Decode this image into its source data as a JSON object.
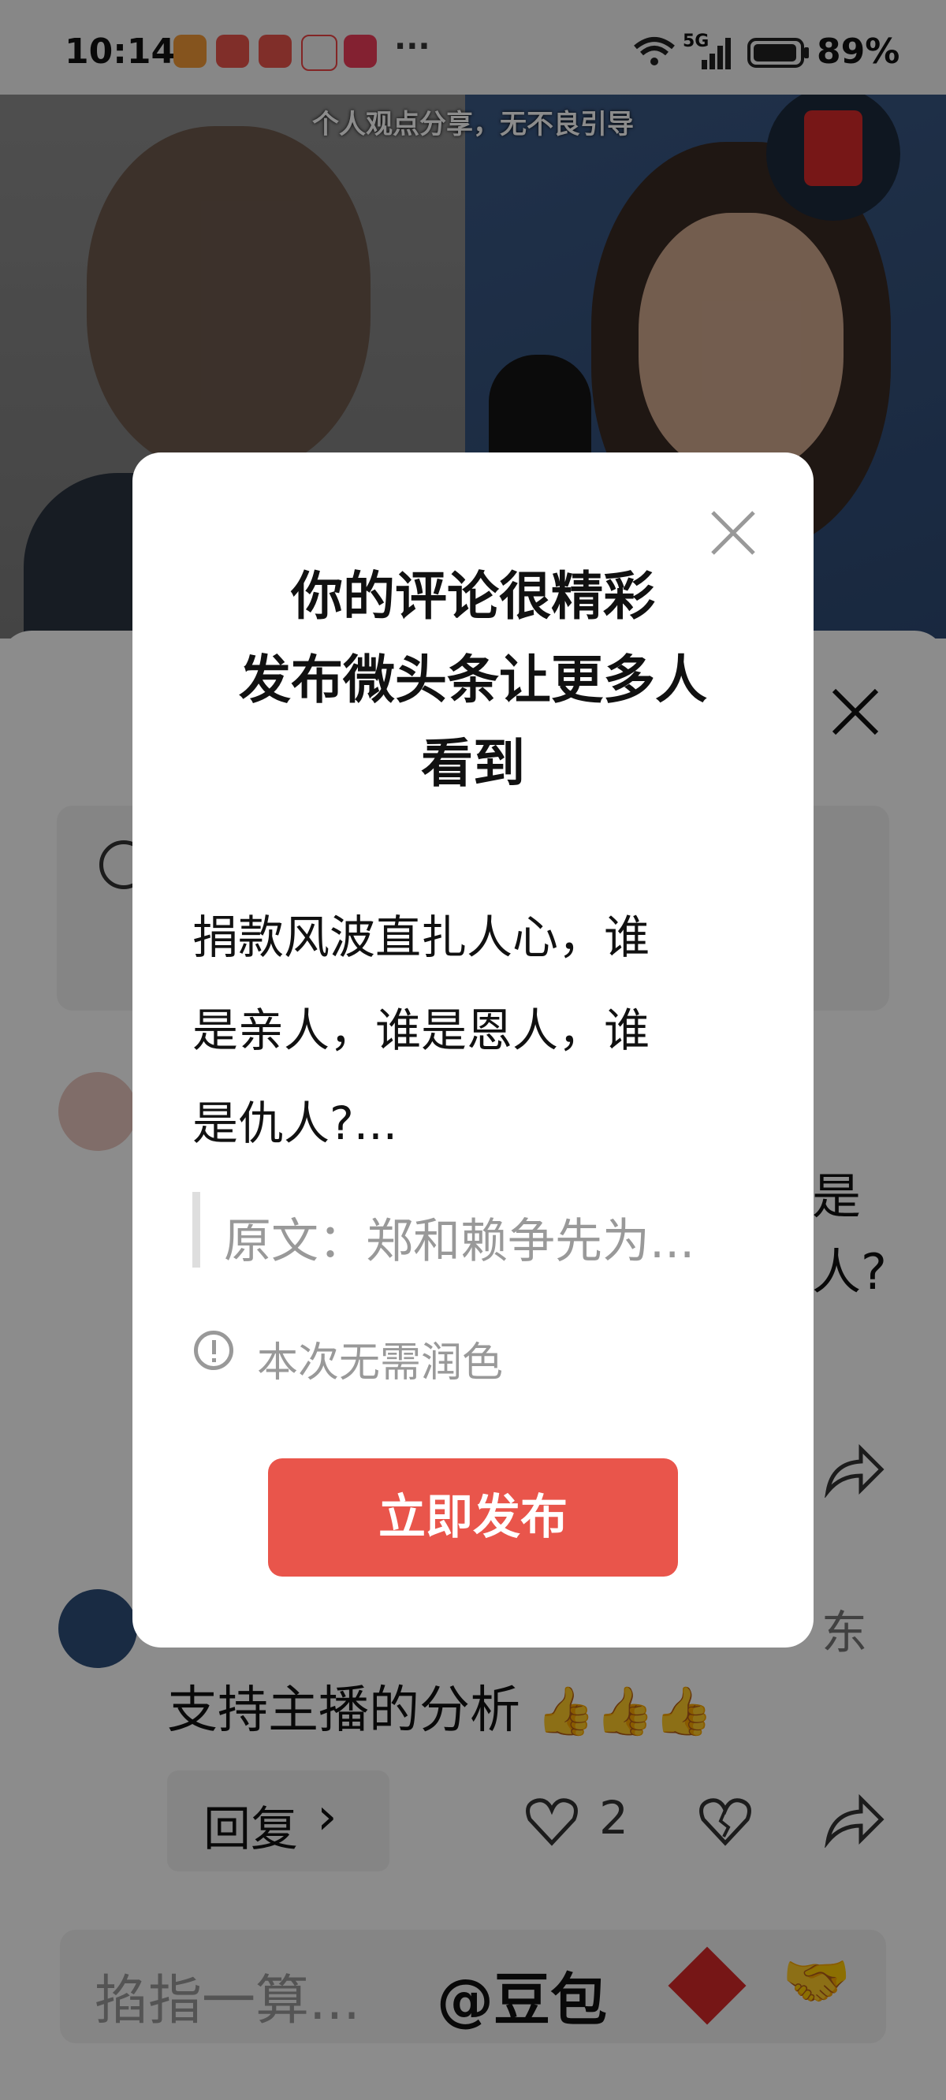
{
  "status_bar": {
    "time": "10:14",
    "more": "···",
    "network": "5G",
    "battery": "89%"
  },
  "video": {
    "caption": "个人观点分享，无不良引导"
  },
  "comments": [
    {
      "text": "是\n人?"
    },
    {
      "location_fragment": "东",
      "text": "支持主播的分析",
      "reply_label": "回复",
      "reply_chevron": "›",
      "like_count": "2"
    }
  ],
  "input": {
    "placeholder": "掐指一算...",
    "mention": "@豆包"
  },
  "dialog": {
    "title_line1": "你的评论很精彩",
    "title_line2": "发布微头条让更多人",
    "title_line3": "看到",
    "body_line1": "捐款风波直扎人心，谁",
    "body_line2": "是亲人，谁是恩人，谁",
    "body_line3": "是仇人?...",
    "quote": "原文：郑和赖争先为...",
    "notice": "本次无需润色",
    "publish_label": "立即发布"
  },
  "colors": {
    "accent": "#e9554b",
    "overlay": "rgba(0,0,0,0.45)"
  },
  "icons": [
    "heart-app-icon",
    "app-icon",
    "app-icon",
    "app-icon",
    "video-app-icon",
    "wifi-icon",
    "signal-icon",
    "battery-icon",
    "close-icon",
    "info-icon",
    "heart-icon",
    "broken-heart-icon",
    "share-icon",
    "fu-emoji-icon",
    "handshake-emoji-icon",
    "thumbs-up-emoji-icon"
  ]
}
